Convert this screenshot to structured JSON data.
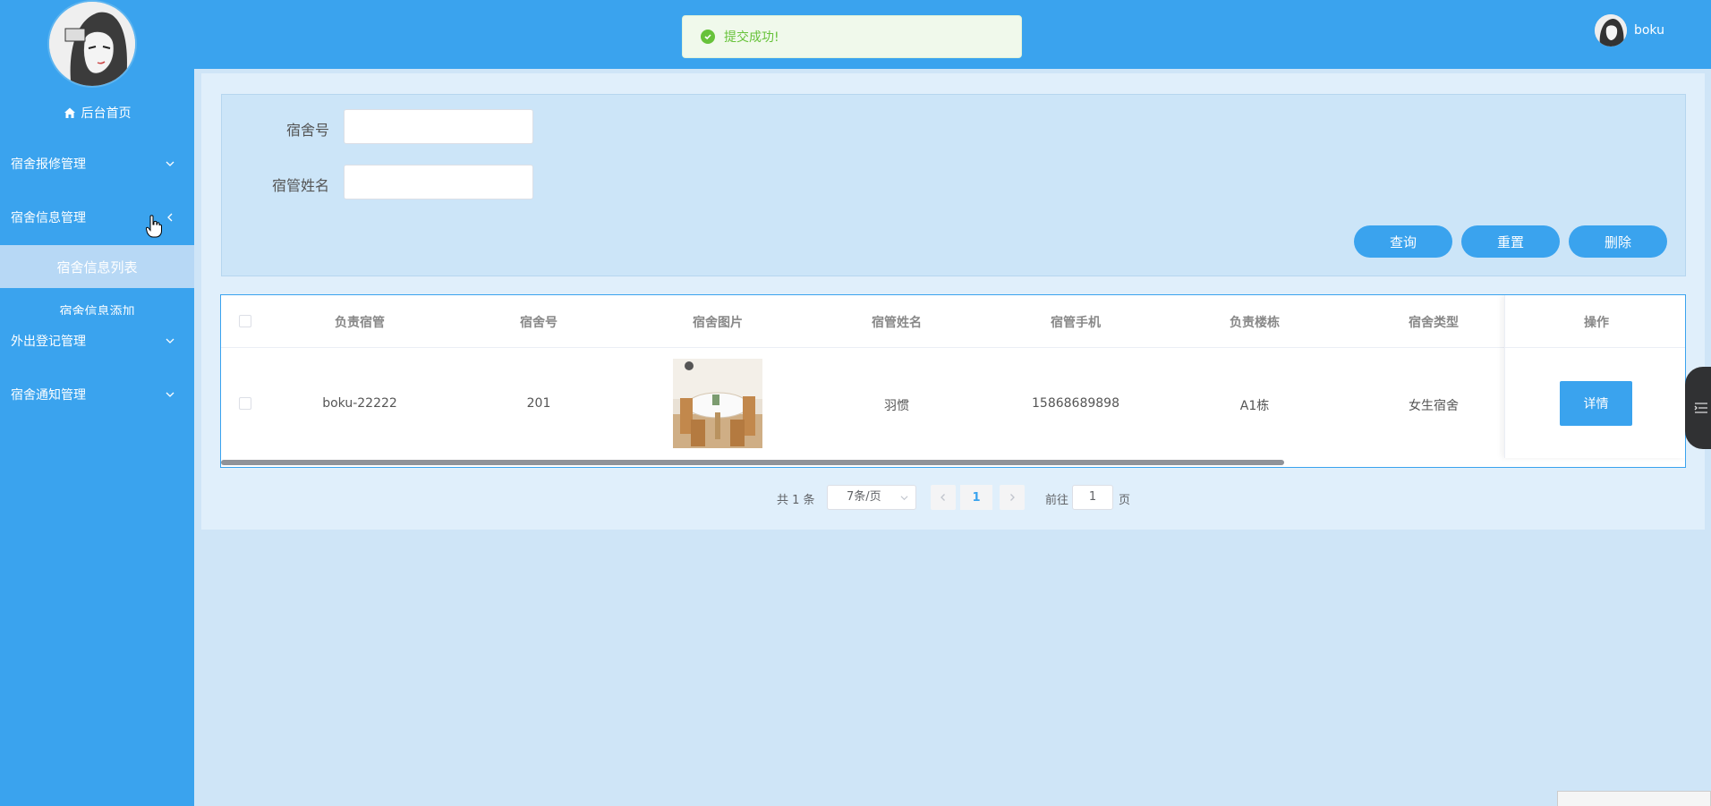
{
  "sidebar": {
    "home_label": "后台首页",
    "menus": [
      {
        "label": "宿舍报修管理"
      },
      {
        "label": "宿舍信息管理"
      },
      {
        "label": "外出登记管理"
      },
      {
        "label": "宿舍通知管理"
      }
    ],
    "submenu": {
      "active": "宿舍信息列表",
      "next": "宿舍信息添加"
    }
  },
  "topbar": {
    "username": "boku"
  },
  "toast": {
    "message": "提交成功!"
  },
  "search": {
    "fields": [
      {
        "label": "宿舍号",
        "value": ""
      },
      {
        "label": "宿管姓名",
        "value": ""
      }
    ],
    "buttons": {
      "query": "查询",
      "reset": "重置",
      "delete": "删除"
    }
  },
  "table": {
    "columns": [
      "负责宿管",
      "宿舍号",
      "宿舍图片",
      "宿管姓名",
      "宿管手机",
      "负责楼栋",
      "宿舍类型",
      "操作"
    ],
    "rows": [
      {
        "manager_account": "boku-22222",
        "room_no": "201",
        "manager_name": "羽惯",
        "manager_phone": "15868689898",
        "building": "A1栋",
        "room_type": "女生宿舍",
        "action": "详情"
      }
    ]
  },
  "pagination": {
    "total": "共 1 条",
    "page_size": "7条/页",
    "current_page": "1",
    "goto_label": "前往",
    "goto_value": "1",
    "page_suffix": "页"
  },
  "colors": {
    "primary": "#3aa3ee",
    "success": "#67c23a"
  }
}
